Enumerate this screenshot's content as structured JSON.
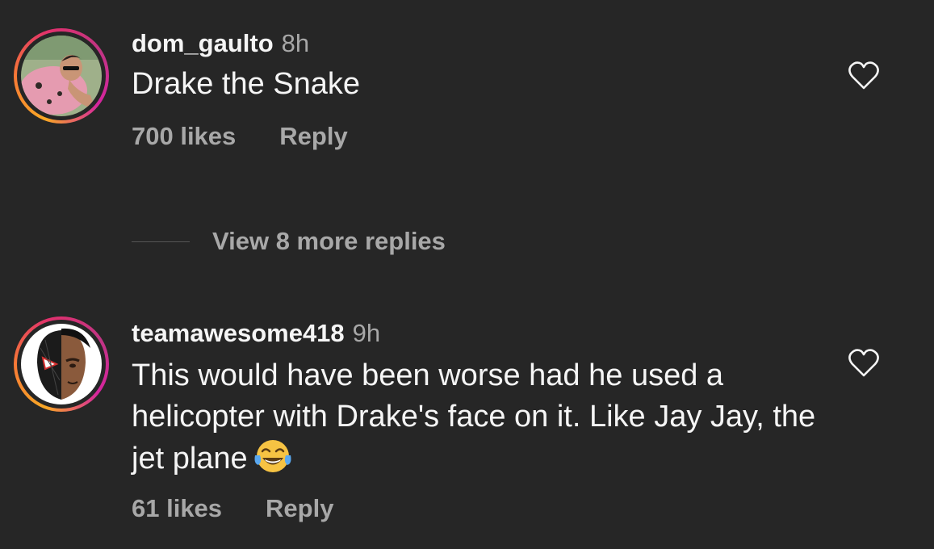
{
  "comments": [
    {
      "username": "dom_gaulto",
      "time": "8h",
      "text": "Drake the Snake",
      "likes": "700 likes",
      "reply_label": "Reply",
      "avatar_icon": "beach-photo-avatar"
    },
    {
      "username": "teamawesome418",
      "time": "9h",
      "text": "This would have been worse had he used a helicopter with Drake's face on it. Like Jay Jay, the jet plane",
      "emoji": "face-with-tears-of-joy",
      "likes": "61 likes",
      "reply_label": "Reply",
      "avatar_icon": "spider-man-miles-avatar"
    }
  ],
  "view_replies": "View 8 more replies",
  "colors": {
    "background": "#262626",
    "primary_text": "#f5f5f5",
    "secondary_text": "#a8a8a8"
  }
}
